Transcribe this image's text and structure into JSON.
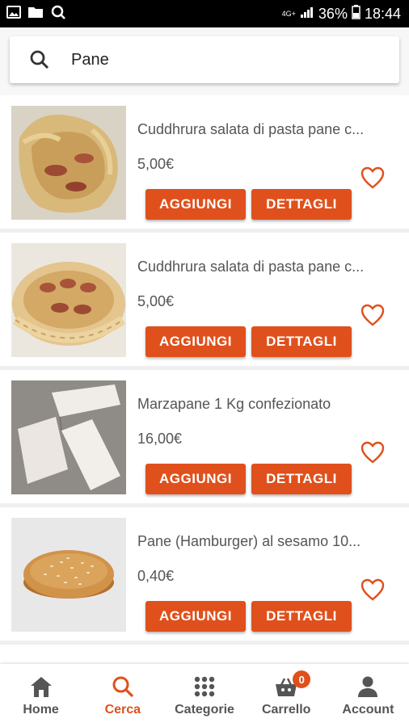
{
  "status_bar": {
    "network": "4G+",
    "battery": "36%",
    "time": "18:44",
    "icons": [
      "image-icon",
      "folder-icon",
      "search-notification-icon",
      "signal-icon",
      "battery-icon"
    ]
  },
  "search": {
    "value": "Pane",
    "icon": "search-icon"
  },
  "products": [
    {
      "name": "Cuddhrura salata di pasta pane c...",
      "price": "5,00€",
      "add_label": "AGGIUNGI",
      "details_label": "DETTAGLI"
    },
    {
      "name": "Cuddhrura salata di pasta pane c...",
      "price": "5,00€",
      "add_label": "AGGIUNGI",
      "details_label": "DETTAGLI"
    },
    {
      "name": "Marzapane 1 Kg confezionato",
      "price": "16,00€",
      "add_label": "AGGIUNGI",
      "details_label": "DETTAGLI"
    },
    {
      "name": "Pane (Hamburger) al sesamo 10...",
      "price": "0,40€",
      "add_label": "AGGIUNGI",
      "details_label": "DETTAGLI"
    }
  ],
  "bottom_nav": {
    "items": [
      {
        "label": "Home",
        "icon": "home-icon"
      },
      {
        "label": "Cerca",
        "icon": "search-icon",
        "active": true
      },
      {
        "label": "Categorie",
        "icon": "grid-icon"
      },
      {
        "label": "Carrello",
        "icon": "cart-icon",
        "badge": "0"
      },
      {
        "label": "Account",
        "icon": "account-icon"
      }
    ]
  },
  "colors": {
    "accent": "#e0501c",
    "text": "#555555",
    "status_bar": "#000000"
  }
}
